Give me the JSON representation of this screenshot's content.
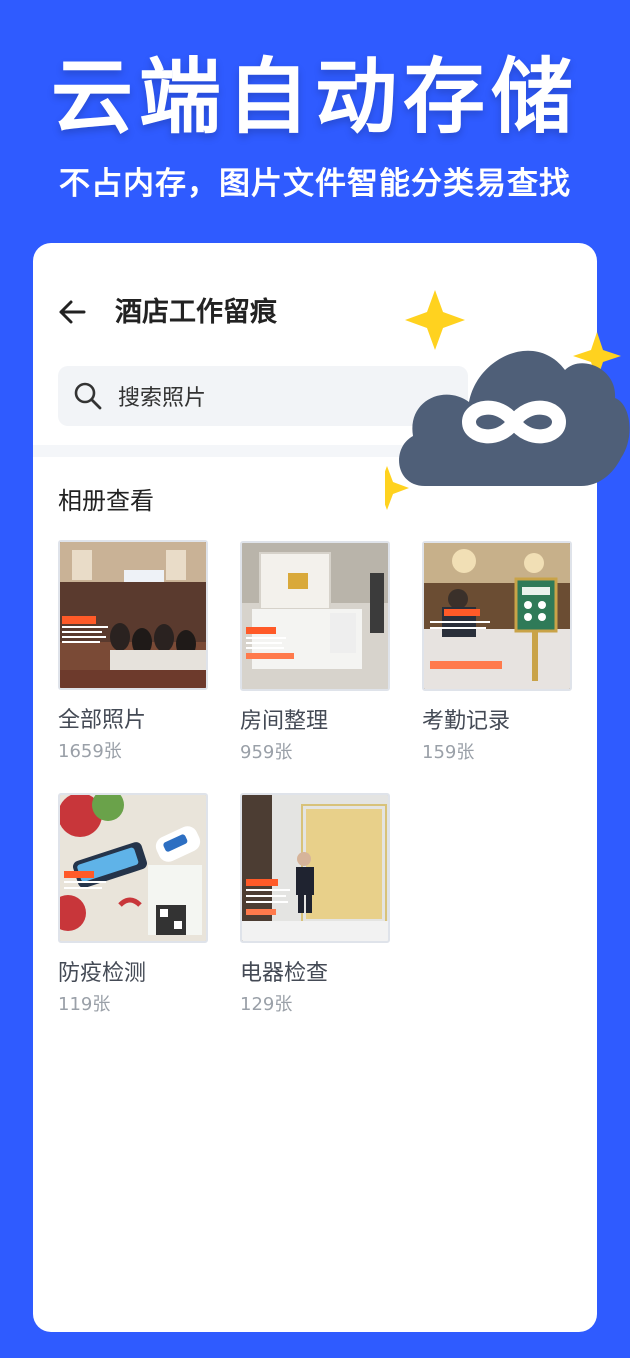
{
  "hero": {
    "title": "云端自动存储",
    "subtitle": "不占内存，图片文件智能分类易查找"
  },
  "nav": {
    "back_icon": "arrow-left-icon",
    "title": "酒店工作留痕"
  },
  "search": {
    "icon": "search-icon",
    "placeholder": "搜索照片"
  },
  "section": {
    "title": "相册查看"
  },
  "albums": [
    {
      "name": "全部照片",
      "count": "1659张",
      "theme": "conference-room"
    },
    {
      "name": "房间整理",
      "count": "959张",
      "theme": "hotel-room"
    },
    {
      "name": "考勤记录",
      "count": "159张",
      "theme": "lobby-checkin"
    },
    {
      "name": "防疫检测",
      "count": "119张",
      "theme": "health-code-scan"
    },
    {
      "name": "电器检查",
      "count": "129张",
      "theme": "appliance-check"
    }
  ],
  "decoration": {
    "cloud_icon": "cloud-infinity-icon",
    "sparkle_icon": "sparkle-icon",
    "colors": {
      "background": "#2f5bff",
      "cloud": "#4f5f78",
      "sparkle": "#ffd21f",
      "stamp": "#ff5a28"
    }
  }
}
